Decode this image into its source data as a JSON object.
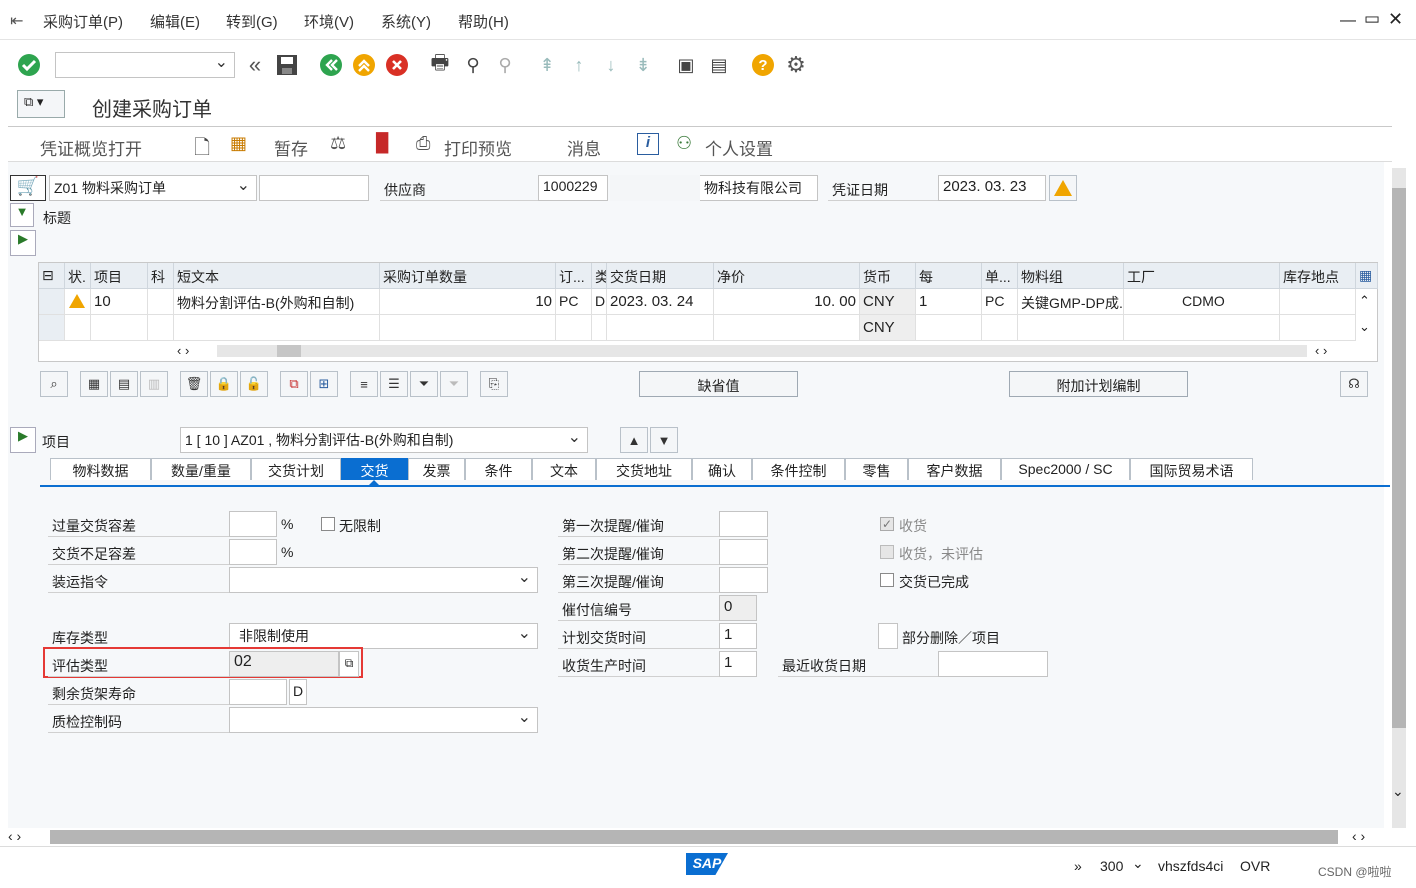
{
  "menu": {
    "items": [
      "采购订单(P)",
      "编辑(E)",
      "转到(G)",
      "环境(V)",
      "系统(Y)",
      "帮助(H)"
    ]
  },
  "screen_title": "创建采购订单",
  "app_toolbar": {
    "overview": "凭证概览打开",
    "hold": "暂存",
    "print_preview": "打印预览",
    "messages": "消息",
    "personal_settings": "个人设置"
  },
  "header": {
    "doc_type": "Z01 物料采购订单",
    "vendor_label": "供应商",
    "vendor_value": "1000229",
    "vendor_name": "物科技有限公司",
    "doc_date_label": "凭证日期",
    "doc_date_value": "2023. 03. 23",
    "header_label": "标题"
  },
  "grid": {
    "columns": [
      "状.",
      "项目",
      "科",
      "短文本",
      "采购订单数量",
      "订...",
      "类",
      "交货日期",
      "净价",
      "货币",
      "每",
      "单...",
      "物料组",
      "工厂",
      "库存地点"
    ],
    "rows": [
      {
        "item": "10",
        "short_text": "物料分割评估-B(外购和自制)",
        "qty": "10",
        "unit": "PC",
        "cat": "D",
        "date": "2023. 03. 24",
        "price": "10. 00",
        "currency": "CNY",
        "per": "1",
        "unit2": "PC",
        "matgroup": "关键GMP-DP成...",
        "plant": "CDMO"
      },
      {
        "item": "",
        "short_text": "",
        "qty": "",
        "unit": "",
        "cat": "",
        "date": "",
        "price": "",
        "currency": "CNY",
        "per": "",
        "unit2": "",
        "matgroup": "",
        "plant": ""
      }
    ]
  },
  "buttons": {
    "defaults": "缺省值",
    "add_planning": "附加计划编制"
  },
  "item_detail": {
    "label": "项目",
    "selector": "1 [ 10 ] AZ01 , 物料分割评估-B(外购和自制)"
  },
  "tabs": [
    "物料数据",
    "数量/重量",
    "交货计划",
    "交货",
    "发票",
    "条件",
    "文本",
    "交货地址",
    "确认",
    "条件控制",
    "零售",
    "客户数据",
    "Spec2000 / SC",
    "国际贸易术语"
  ],
  "active_tab": "交货",
  "delivery": {
    "overdelivery_label": "过量交货容差",
    "pct1": "%",
    "unlimited_label": "无限制",
    "underdelivery_label": "交货不足容差",
    "pct2": "%",
    "shipping_label": "装运指令",
    "stock_type_label": "库存类型",
    "stock_type_value": "非限制使用",
    "valuation_label": "评估类型",
    "valuation_value": "02",
    "shelf_life_label": "剩余货架寿命",
    "shelf_life_unit": "D",
    "qm_label": "质检控制码",
    "reminder1_label": "第一次提醒/催询",
    "reminder2_label": "第二次提醒/催询",
    "reminder3_label": "第三次提醒/催询",
    "dunning_label": "催付信编号",
    "dunning_value": "0",
    "planned_delivery_label": "计划交货时间",
    "planned_delivery_value": "1",
    "gr_processing_label": "收货生产时间",
    "gr_processing_value": "1",
    "last_gr_label": "最近收货日期",
    "gr_label": "收货",
    "gr_nonval_label": "收货，未评估",
    "delivery_complete_label": "交货已完成",
    "partial_delete_label": "部分删除／项目"
  },
  "status": {
    "client": "300",
    "server": "vhszfds4ci",
    "mode": "OVR",
    "watermark": "CSDN @啦啦"
  },
  "colors": {
    "accent": "#0a6ed1",
    "highlight_box": "#e53935",
    "green": "#2ea44f",
    "orange": "#f0a500"
  }
}
